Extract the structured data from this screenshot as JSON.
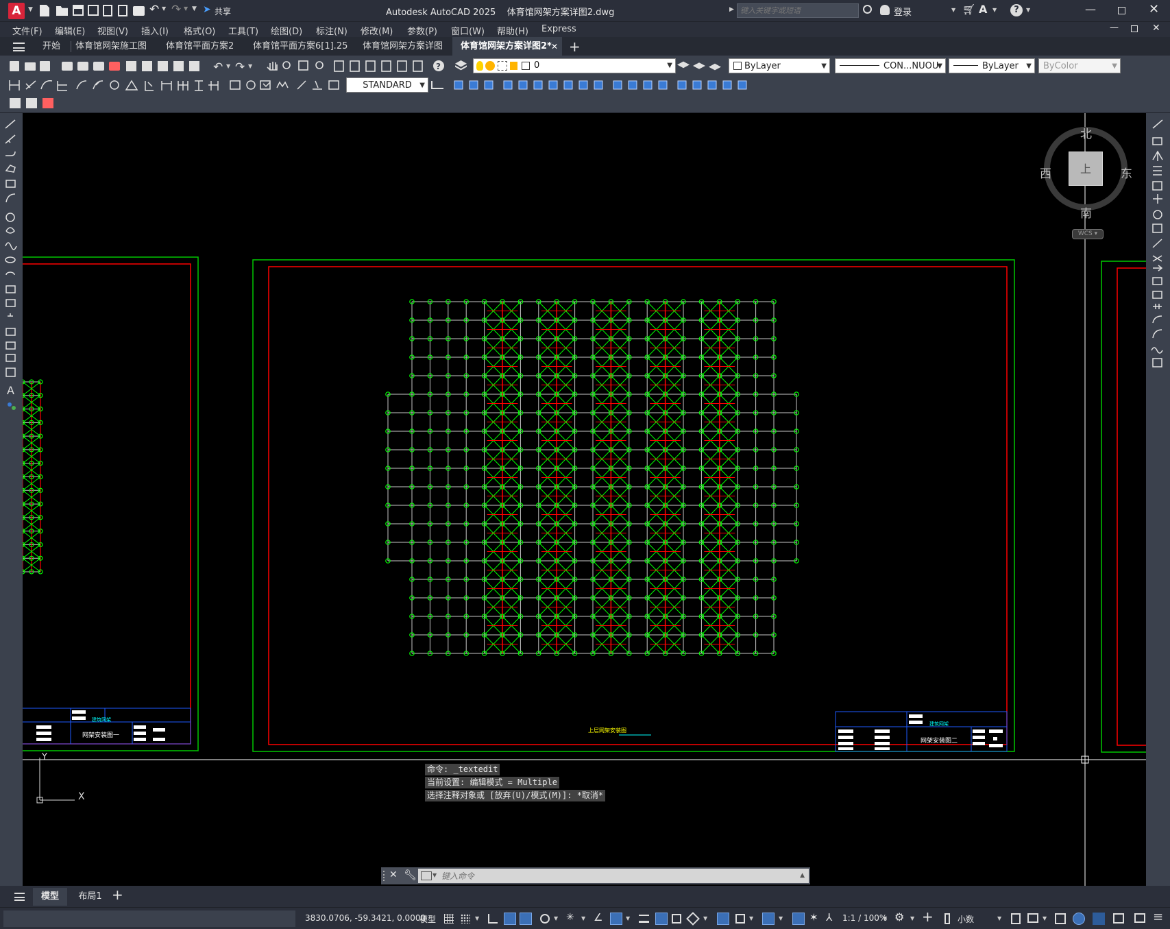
{
  "app": {
    "logo_letter": "A",
    "title": "Autodesk AutoCAD 2025",
    "document": "体育馆网架方案详图2.dwg",
    "search_placeholder": "键入关键字或短语",
    "login_label": "登录",
    "share_label": "共享"
  },
  "menu": [
    "文件(F)",
    "编辑(E)",
    "视图(V)",
    "插入(I)",
    "格式(O)",
    "工具(T)",
    "绘图(D)",
    "标注(N)",
    "修改(M)",
    "参数(P)",
    "窗口(W)",
    "帮助(H)",
    "Express"
  ],
  "tabs": [
    {
      "label": "开始",
      "active": false
    },
    {
      "label": "体育馆网架施工图",
      "active": false
    },
    {
      "label": "体育馆平面方案2",
      "active": false
    },
    {
      "label": "体育馆平面方案6[1].25",
      "active": false
    },
    {
      "label": "体育馆网架方案详图",
      "active": false
    },
    {
      "label": "体育馆网架方案详图2*",
      "active": true
    }
  ],
  "toolbar": {
    "layer_value": "0",
    "color_value": "ByLayer",
    "linetype_value": "CON...NUOU",
    "lineweight_value": "ByLayer",
    "plotstyle_value": "ByColor",
    "textstyle_value": "STANDARD"
  },
  "viewcube": {
    "north": "北",
    "south": "南",
    "east": "东",
    "west": "西",
    "face": "上",
    "wcs": "WCS"
  },
  "drawing": {
    "main_caption": "上层网架安装图",
    "left_title_block": {
      "header": "建筑网架",
      "name": "网架安装图一"
    },
    "right_title_block": {
      "header": "建筑网架",
      "name": "网架安装图二"
    },
    "colors": {
      "frame": "#00c800",
      "border": "#ff0000",
      "grid": "#c8c8c8",
      "node": "#00ff00",
      "brace": "#ff0000",
      "titleblock": "#1e5aff",
      "caption": "#ffff00"
    }
  },
  "ucs": {
    "x_label": "X",
    "y_label": "Y"
  },
  "command": {
    "history": [
      "命令: _textedit",
      "当前设置: 编辑模式 = Multiple",
      "选择注释对象或 [放弃(U)/模式(M)]: *取消*"
    ],
    "placeholder": "键入命令"
  },
  "layouts": [
    {
      "label": "模型",
      "active": true
    },
    {
      "label": "布局1",
      "active": false
    }
  ],
  "status": {
    "coords": "3830.0706, -59.3421, 0.0000",
    "model_label": "模型",
    "scale": "1:1 / 100%",
    "units": "小数"
  }
}
